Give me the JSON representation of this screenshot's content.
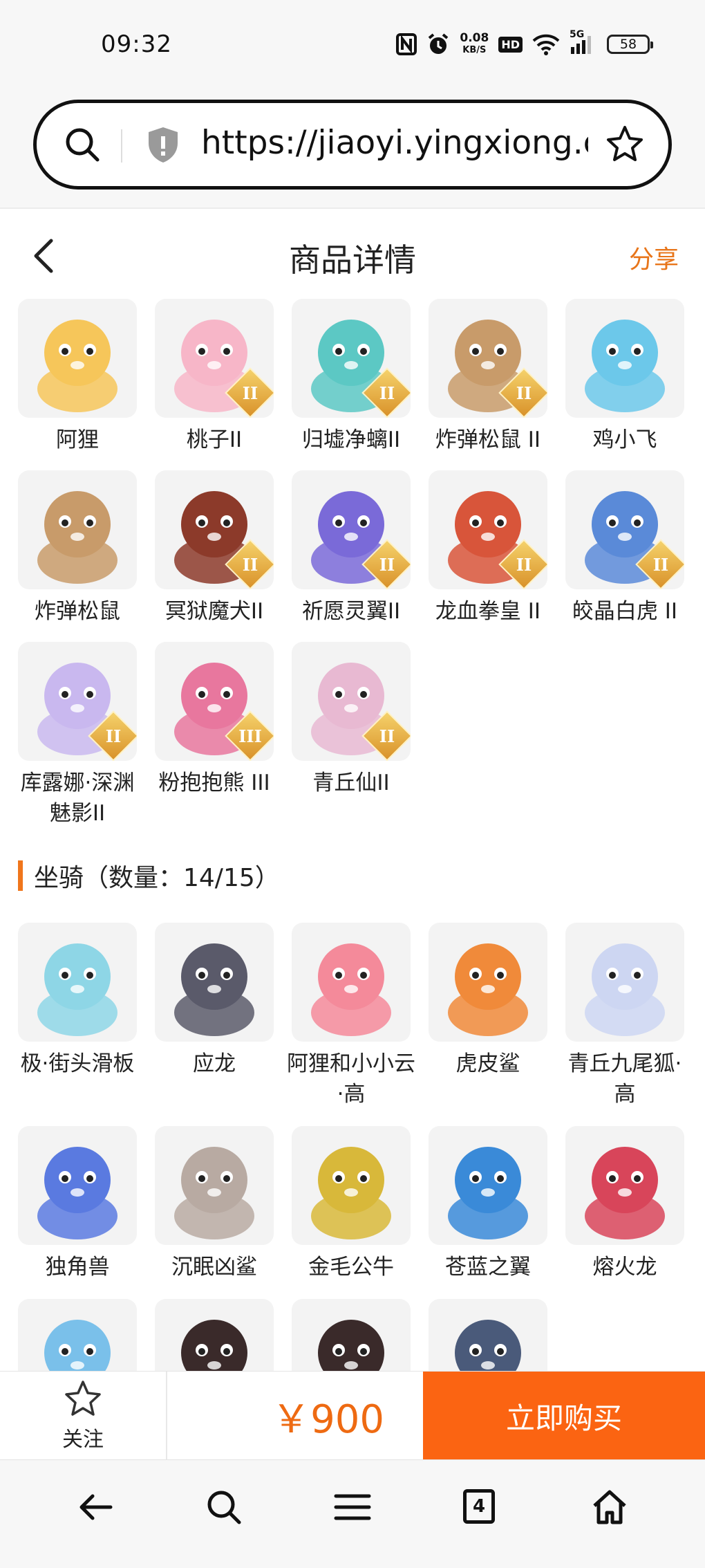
{
  "status": {
    "time": "09:32",
    "net_speed_value": "0.08",
    "net_speed_unit": "KB/S",
    "hd": "HD",
    "signal": "5G",
    "battery": "58"
  },
  "browser": {
    "url": "https://jiaoyi.yingxiong.co..."
  },
  "header": {
    "title": "商品详情",
    "share": "分享"
  },
  "pets": [
    {
      "name": "阿狸",
      "tier": "",
      "color": "#f6c65a"
    },
    {
      "name": "桃子II",
      "tier": "II",
      "color": "#f7b6c8"
    },
    {
      "name": "归墟净螭II",
      "tier": "II",
      "color": "#5cc8c4"
    },
    {
      "name": "炸弹松鼠 II",
      "tier": "II",
      "color": "#c89b6a"
    },
    {
      "name": "鸡小飞",
      "tier": "",
      "color": "#6cc8ea"
    },
    {
      "name": "炸弹松鼠",
      "tier": "",
      "color": "#c89b6a"
    },
    {
      "name": "冥狱魔犬II",
      "tier": "II",
      "color": "#8c3a2a"
    },
    {
      "name": "祈愿灵翼II",
      "tier": "II",
      "color": "#7a6ad8"
    },
    {
      "name": "龙血拳皇 II",
      "tier": "II",
      "color": "#d8553a"
    },
    {
      "name": "皎晶白虎 II",
      "tier": "II",
      "color": "#5a8ad8"
    },
    {
      "name": "库露娜·深渊魅影II",
      "tier": "II",
      "color": "#c9b8ef"
    },
    {
      "name": "粉抱抱熊 III",
      "tier": "III",
      "color": "#e8779e"
    },
    {
      "name": "青丘仙II",
      "tier": "II",
      "color": "#e8b9d2"
    }
  ],
  "mounts_section": {
    "title": "坐骑（数量：14/15）"
  },
  "mounts": [
    {
      "name": "极·街头滑板",
      "color": "#8ed6e6"
    },
    {
      "name": "应龙",
      "color": "#5a5a6a"
    },
    {
      "name": "阿狸和小小云·高",
      "color": "#f48a9a"
    },
    {
      "name": "虎皮鲨",
      "color": "#f08a3a"
    },
    {
      "name": "青丘九尾狐·高",
      "color": "#cdd6f2"
    },
    {
      "name": "独角兽",
      "color": "#5a7ae0"
    },
    {
      "name": "沉眠凶鲨",
      "color": "#b8aaa2"
    },
    {
      "name": "金毛公牛",
      "color": "#d8b83a"
    },
    {
      "name": "苍蓝之翼",
      "color": "#3a8ad8"
    },
    {
      "name": "熔火龙",
      "color": "#d8455a"
    },
    {
      "name": "",
      "color": "#7ac0ea"
    },
    {
      "name": "",
      "color": "#3a2a2a"
    },
    {
      "name": "",
      "color": "#3a2a2a"
    },
    {
      "name": "",
      "color": "#4a5a7a"
    }
  ],
  "buybar": {
    "follow": "关注",
    "price": "￥900",
    "buy": "立即购买"
  },
  "nav": {
    "tab_count": "4"
  }
}
